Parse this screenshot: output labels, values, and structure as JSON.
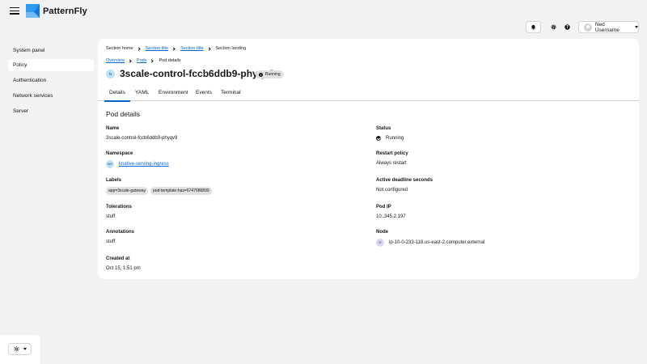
{
  "brand": {
    "name": "PatternFly",
    "accent": "#0066cc"
  },
  "masthead": {
    "user_name": "Ned Username",
    "icons": [
      "menu-icon",
      "bell-icon",
      "gear-icon",
      "help-icon",
      "avatar",
      "chevron-down-icon"
    ]
  },
  "sidebar": {
    "items": [
      {
        "label": "System panel",
        "active": false
      },
      {
        "label": "Policy",
        "active": true
      },
      {
        "label": "Authentication",
        "active": false
      },
      {
        "label": "Network services",
        "active": false
      },
      {
        "label": "Server",
        "active": false
      }
    ],
    "theme_icon": "sun-icon"
  },
  "breadcrumb": [
    "Section home",
    "Section title",
    "Section title",
    "Section landing"
  ],
  "sub_breadcrumb": [
    "Overview",
    "Pods",
    "Pod details"
  ],
  "pod": {
    "badge": "N",
    "name": "3scale-control-fccb6ddb9-phyqv9",
    "status": "Running",
    "status_icon": "info-icon"
  },
  "tabs": [
    "Details",
    "YAML",
    "Environment",
    "Events",
    "Terminal"
  ],
  "details": {
    "title": "Pod details",
    "name_label": "Name",
    "name_value": "3scale-control-fccb6ddb9-phyqv9",
    "namespace_label": "Namespace",
    "namespace_badge": "NS",
    "namespace_value": "knative-serving-ingress",
    "labels_label": "Labels",
    "labels": [
      "app=3scale-gateway",
      "pod-template-has=6747686899"
    ],
    "tolerations_label": "Tolerations",
    "tolerations_value": "stuff",
    "annotations_label": "Annotations",
    "annotations_value": "stuff",
    "created_label": "Created at",
    "created_value": "Oct 15, 1:51 pm",
    "status_label": "Status",
    "status_value": "Running",
    "restart_label": "Restart policy",
    "restart_value": "Always restart",
    "deadline_label": "Active deadline seconds",
    "deadline_value": "Not configured",
    "pod_ip_label": "Pod IP",
    "pod_ip_value": "10..345.2.197",
    "node_label": "Node",
    "node_badge": "N",
    "node_value": "ip-10-0-233-118.us-east-2.computer.external"
  }
}
